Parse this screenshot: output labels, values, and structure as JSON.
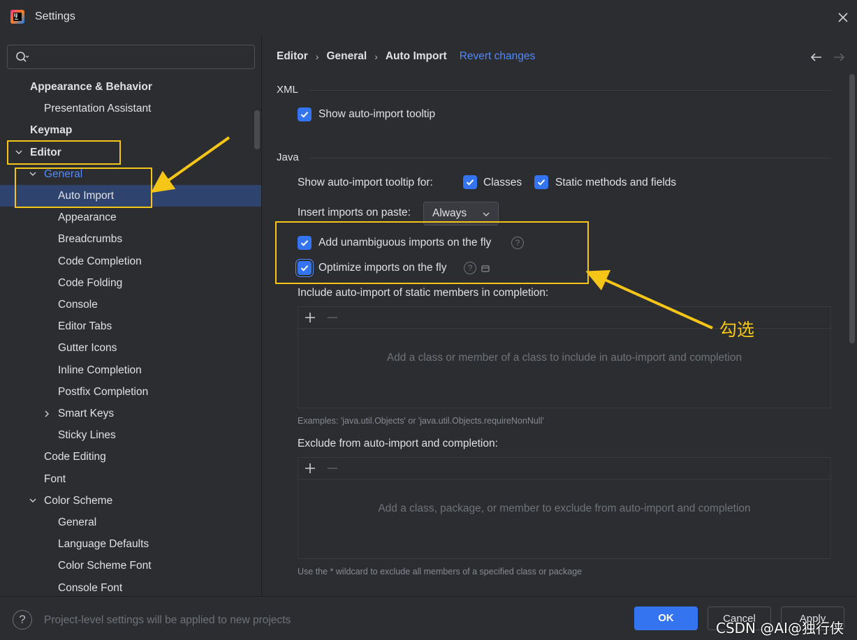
{
  "window": {
    "title": "Settings"
  },
  "search": {
    "placeholder": ""
  },
  "tree": {
    "items": [
      {
        "label": "Appearance & Behavior",
        "level": 0,
        "bold": true,
        "expander": "none"
      },
      {
        "label": "Presentation Assistant",
        "level": 1,
        "bold": false,
        "expander": "none"
      },
      {
        "label": "Keymap",
        "level": 0,
        "bold": true,
        "expander": "none"
      },
      {
        "label": "Editor",
        "level": 0,
        "bold": true,
        "expander": "expanded"
      },
      {
        "label": "General",
        "level": 1,
        "bold": false,
        "expander": "expanded",
        "accent": true
      },
      {
        "label": "Auto Import",
        "level": 2,
        "bold": false,
        "expander": "none",
        "selected": true
      },
      {
        "label": "Appearance",
        "level": 2,
        "bold": false,
        "expander": "none"
      },
      {
        "label": "Breadcrumbs",
        "level": 2,
        "bold": false,
        "expander": "none"
      },
      {
        "label": "Code Completion",
        "level": 2,
        "bold": false,
        "expander": "none"
      },
      {
        "label": "Code Folding",
        "level": 2,
        "bold": false,
        "expander": "none"
      },
      {
        "label": "Console",
        "level": 2,
        "bold": false,
        "expander": "none"
      },
      {
        "label": "Editor Tabs",
        "level": 2,
        "bold": false,
        "expander": "none"
      },
      {
        "label": "Gutter Icons",
        "level": 2,
        "bold": false,
        "expander": "none"
      },
      {
        "label": "Inline Completion",
        "level": 2,
        "bold": false,
        "expander": "none"
      },
      {
        "label": "Postfix Completion",
        "level": 2,
        "bold": false,
        "expander": "none"
      },
      {
        "label": "Smart Keys",
        "level": 2,
        "bold": false,
        "expander": "collapsed"
      },
      {
        "label": "Sticky Lines",
        "level": 2,
        "bold": false,
        "expander": "none"
      },
      {
        "label": "Code Editing",
        "level": 1,
        "bold": false,
        "expander": "none"
      },
      {
        "label": "Font",
        "level": 1,
        "bold": false,
        "expander": "none"
      },
      {
        "label": "Color Scheme",
        "level": 1,
        "bold": false,
        "expander": "expanded"
      },
      {
        "label": "General",
        "level": 2,
        "bold": false,
        "expander": "none"
      },
      {
        "label": "Language Defaults",
        "level": 2,
        "bold": false,
        "expander": "none"
      },
      {
        "label": "Color Scheme Font",
        "level": 2,
        "bold": false,
        "expander": "none"
      },
      {
        "label": "Console Font",
        "level": 2,
        "bold": false,
        "expander": "none"
      }
    ]
  },
  "breadcrumb": {
    "items": [
      "Editor",
      "General",
      "Auto Import"
    ],
    "separator": "›",
    "revert_label": "Revert changes"
  },
  "xml": {
    "title": "XML",
    "show_tooltip_label": "Show auto-import tooltip",
    "show_tooltip_checked": true
  },
  "java": {
    "title": "Java",
    "tooltip_for_label": "Show auto-import tooltip for:",
    "classes_label": "Classes",
    "classes_checked": true,
    "static_label": "Static methods and fields",
    "static_checked": true,
    "insert_imports_label": "Insert imports on paste:",
    "insert_imports_value": "Always",
    "add_unambiguous_label": "Add unambiguous imports on the fly",
    "add_unambiguous_checked": true,
    "optimize_label": "Optimize imports on the fly",
    "optimize_checked": true,
    "include_static_label": "Include auto-import of static members in completion:",
    "include_empty_text": "Add a class or member of a class to include in auto-import and completion",
    "include_examples": "Examples: 'java.util.Objects' or 'java.util.Objects.requireNonNull'",
    "exclude_label": "Exclude from auto-import and completion:",
    "exclude_empty_text": "Add a class, package, or member to exclude from auto-import and completion",
    "exclude_hint": "Use the * wildcard to exclude all members of a specified class or package"
  },
  "footer": {
    "help_label": "?",
    "project_text": "Project-level settings will be applied to new projects",
    "ok_label": "OK",
    "cancel_label": "Cancel",
    "apply_label": "Apply"
  },
  "annotation": {
    "label": "勾选",
    "color": "#f5c518"
  },
  "watermark": "CSDN @AI@独行侠",
  "colors": {
    "accent": "#3574f0",
    "link": "#548af7",
    "selection": "#2e436e",
    "background": "#2b2d30"
  }
}
